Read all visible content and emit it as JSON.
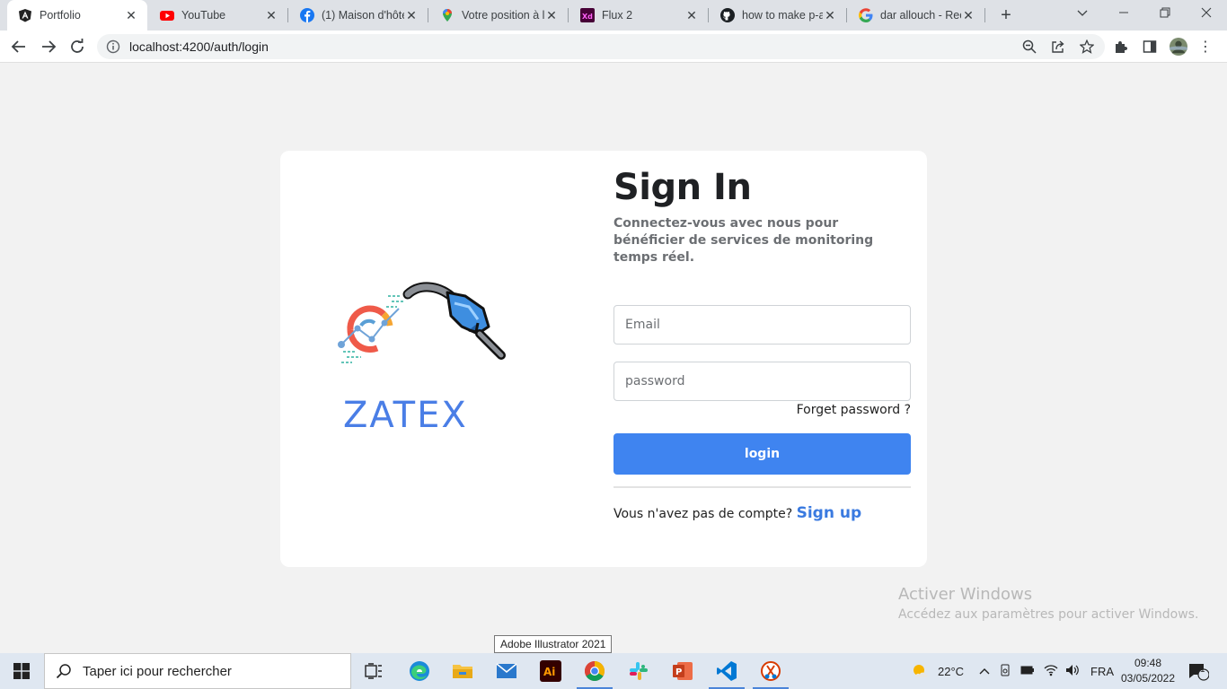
{
  "browser": {
    "tabs": [
      {
        "title": "Portfolio",
        "icon": "angular-icon",
        "active": true
      },
      {
        "title": "YouTube",
        "icon": "youtube-icon"
      },
      {
        "title": "(1) Maison d'hôte",
        "icon": "facebook-icon"
      },
      {
        "title": "Votre position à l",
        "icon": "maps-pin-icon"
      },
      {
        "title": "Flux 2",
        "icon": "adobe-xd-icon"
      },
      {
        "title": "how to make p-a",
        "icon": "github-icon"
      },
      {
        "title": "dar allouch - Rec",
        "icon": "google-icon"
      }
    ],
    "new_tab": "+",
    "url": "localhost:4200/auth/login"
  },
  "page": {
    "brand": "ZATEX",
    "title": "Sign In",
    "subtitle": "Connectez-vous avec nous pour bénéficier de services de monitoring temps réel.",
    "email_placeholder": "Email",
    "password_placeholder": "password",
    "forget_password": "Forget password ?",
    "login_button": "login",
    "no_account": "Vous n'avez pas de compte?",
    "signup_link": "Sign up",
    "accent_color": "#3f84f0"
  },
  "overlay": {
    "tooltip": "Adobe Illustrator 2021",
    "activate_title": "Activer Windows",
    "activate_desc": "Accédez aux paramètres pour activer Windows."
  },
  "taskbar": {
    "search_placeholder": "Taper ici pour rechercher",
    "apps": [
      "task-view",
      "edge",
      "file-explorer",
      "mail",
      "illustrator",
      "chrome",
      "slack",
      "powerpoint",
      "vscode",
      "snipping-tool"
    ],
    "weather": "22°C",
    "language": "FRA",
    "time": "09:48",
    "date": "03/05/2022",
    "notification_count": "1"
  }
}
